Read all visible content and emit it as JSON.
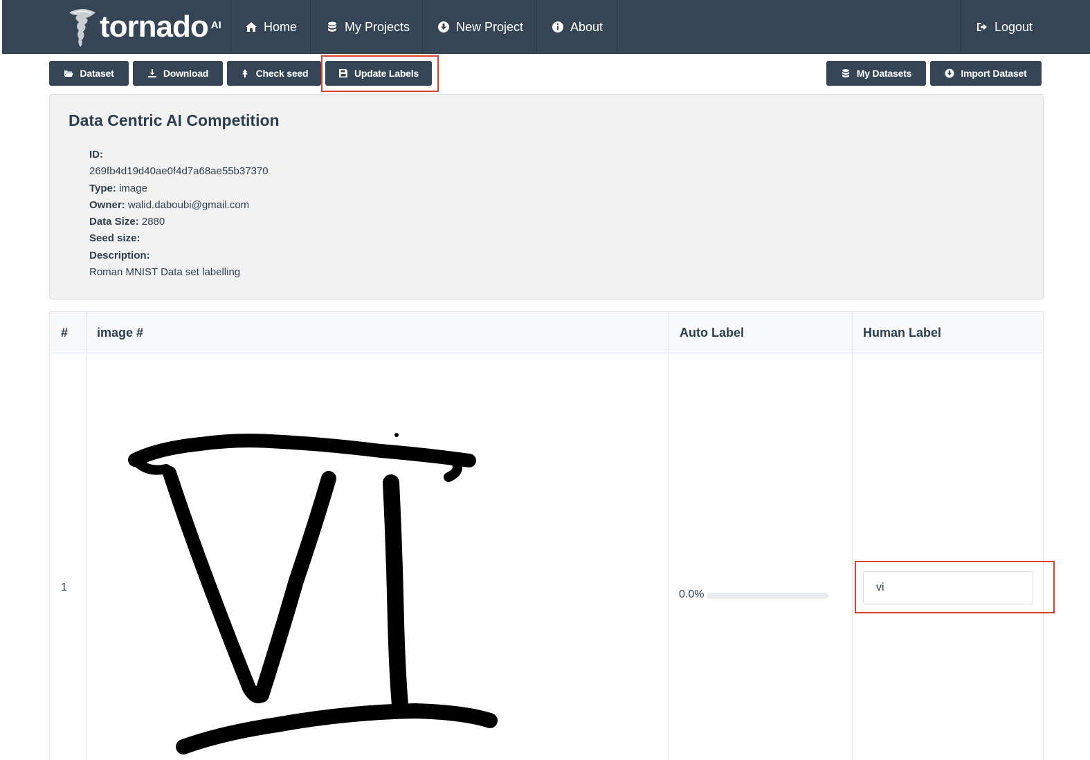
{
  "navbar": {
    "brand": "tornado",
    "brand_sup": "AI",
    "items": [
      {
        "label": "Home",
        "icon": "home-icon"
      },
      {
        "label": "My Projects",
        "icon": "database-icon"
      },
      {
        "label": "New Project",
        "icon": "download-circle-icon"
      },
      {
        "label": "About",
        "icon": "info-circle-icon"
      }
    ],
    "logout": {
      "label": "Logout",
      "icon": "sign-out-icon"
    }
  },
  "toolbar": {
    "dataset": "Dataset",
    "download": "Download",
    "check_seed": "Check seed",
    "update_labels": "Update Labels",
    "my_datasets": "My Datasets",
    "import_dataset": "Import Dataset"
  },
  "project": {
    "title": "Data Centric AI Competition",
    "id_label": "ID:",
    "id_value": "269fb4d19d40ae0f4d7a68ae55b37370",
    "type_label": "Type:",
    "type_value": "image",
    "owner_label": "Owner:",
    "owner_value": "walid.daboubi@gmail.com",
    "data_size_label": "Data Size:",
    "data_size_value": "2880",
    "seed_size_label": "Seed size:",
    "seed_size_value": "",
    "description_label": "Description:",
    "description_value": "Roman MNIST Data set labelling"
  },
  "table": {
    "headers": [
      "#",
      "image #",
      "Auto Label",
      "Human Label"
    ],
    "rows": [
      {
        "num": "1",
        "auto_label_pct": "0.0%",
        "auto_label_fraction": 0.0,
        "human_label": "vi"
      }
    ]
  },
  "colors": {
    "navbar": "#354556",
    "highlight": "#d9422f",
    "panel_bg": "#f2f2f2"
  }
}
